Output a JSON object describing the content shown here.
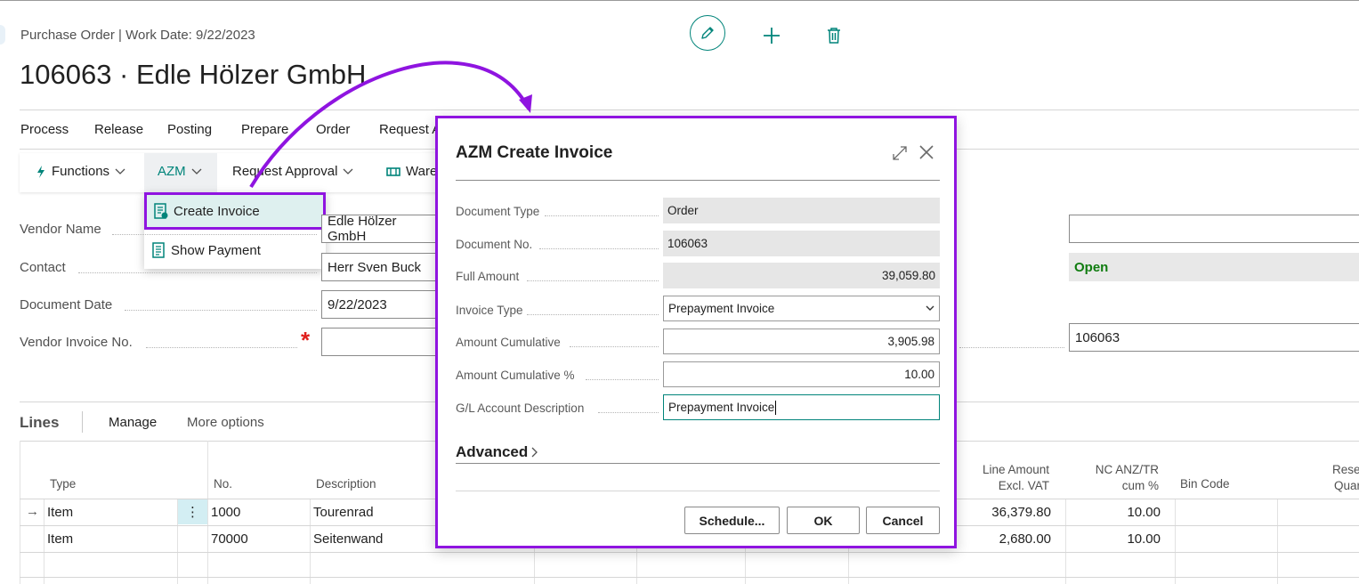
{
  "header": {
    "breadcrumb": "Purchase Order | Work Date: 9/22/2023",
    "title": "106063 · Edle Hölzer GmbH"
  },
  "toolbar": {
    "edit_icon": "pencil-icon",
    "new_icon": "plus-icon",
    "delete_icon": "trash-icon"
  },
  "actions": [
    "Process",
    "Release",
    "Posting",
    "Prepare",
    "Order",
    "Request A"
  ],
  "secondary": {
    "functions": "Functions",
    "azm": "AZM",
    "request_approval": "Request Approval",
    "warehouse": "Ware"
  },
  "azm_menu": {
    "items": [
      {
        "label": "Create Invoice",
        "icon": "invoice-icon"
      },
      {
        "label": "Show Payment",
        "icon": "document-icon"
      }
    ]
  },
  "general": {
    "fields": [
      {
        "label": "Vendor Name",
        "value": "Edle Hölzer GmbH"
      },
      {
        "label": "Contact",
        "value": "Herr Sven Buck"
      },
      {
        "label": "Document Date",
        "value": "9/22/2023"
      },
      {
        "label": "Vendor Invoice No.",
        "value": ""
      }
    ],
    "required_mark": "*",
    "right_input_value": "",
    "status": "Open",
    "right_doc_no": "106063"
  },
  "lines": {
    "title": "Lines",
    "manage": "Manage",
    "more": "More options",
    "headers": {
      "type": "Type",
      "no": "No.",
      "description": "Description",
      "line_amount_1": "Line Amount",
      "line_amount_2": "Excl. VAT",
      "nc_1": "NC ANZ/TR",
      "nc_2": "cum %",
      "bin": "Bin Code",
      "reserved_1": "Rese",
      "reserved_2": "Quar"
    },
    "rows": [
      {
        "arrow": "→",
        "type": "Item",
        "no": "1000",
        "description": "Tourenrad",
        "line_amount": "36,379.80",
        "nc": "10.00"
      },
      {
        "arrow": "",
        "type": "Item",
        "no": "70000",
        "description": "Seitenwand",
        "line_amount": "2,680.00",
        "nc": "10.00"
      }
    ],
    "row_menu": "⋮"
  },
  "dialog": {
    "title": "AZM Create Invoice",
    "fields": [
      {
        "label": "Document Type",
        "value": "Order"
      },
      {
        "label": "Document No.",
        "value": "106063"
      },
      {
        "label": "Full Amount",
        "value": "39,059.80"
      },
      {
        "label": "Invoice Type",
        "value": "Prepayment Invoice"
      },
      {
        "label": "Amount Cumulative",
        "value": "3,905.98"
      },
      {
        "label": "Amount Cumulative %",
        "value": "10.00"
      },
      {
        "label": "G/L Account Description",
        "value": "Prepayment Invoice"
      }
    ],
    "advanced": "Advanced",
    "buttons": {
      "schedule": "Schedule...",
      "ok": "OK",
      "cancel": "Cancel"
    }
  },
  "colors": {
    "accent": "#00847a",
    "highlight": "#8f14e0",
    "status_open": "#107c10",
    "required": "#e0201d"
  }
}
